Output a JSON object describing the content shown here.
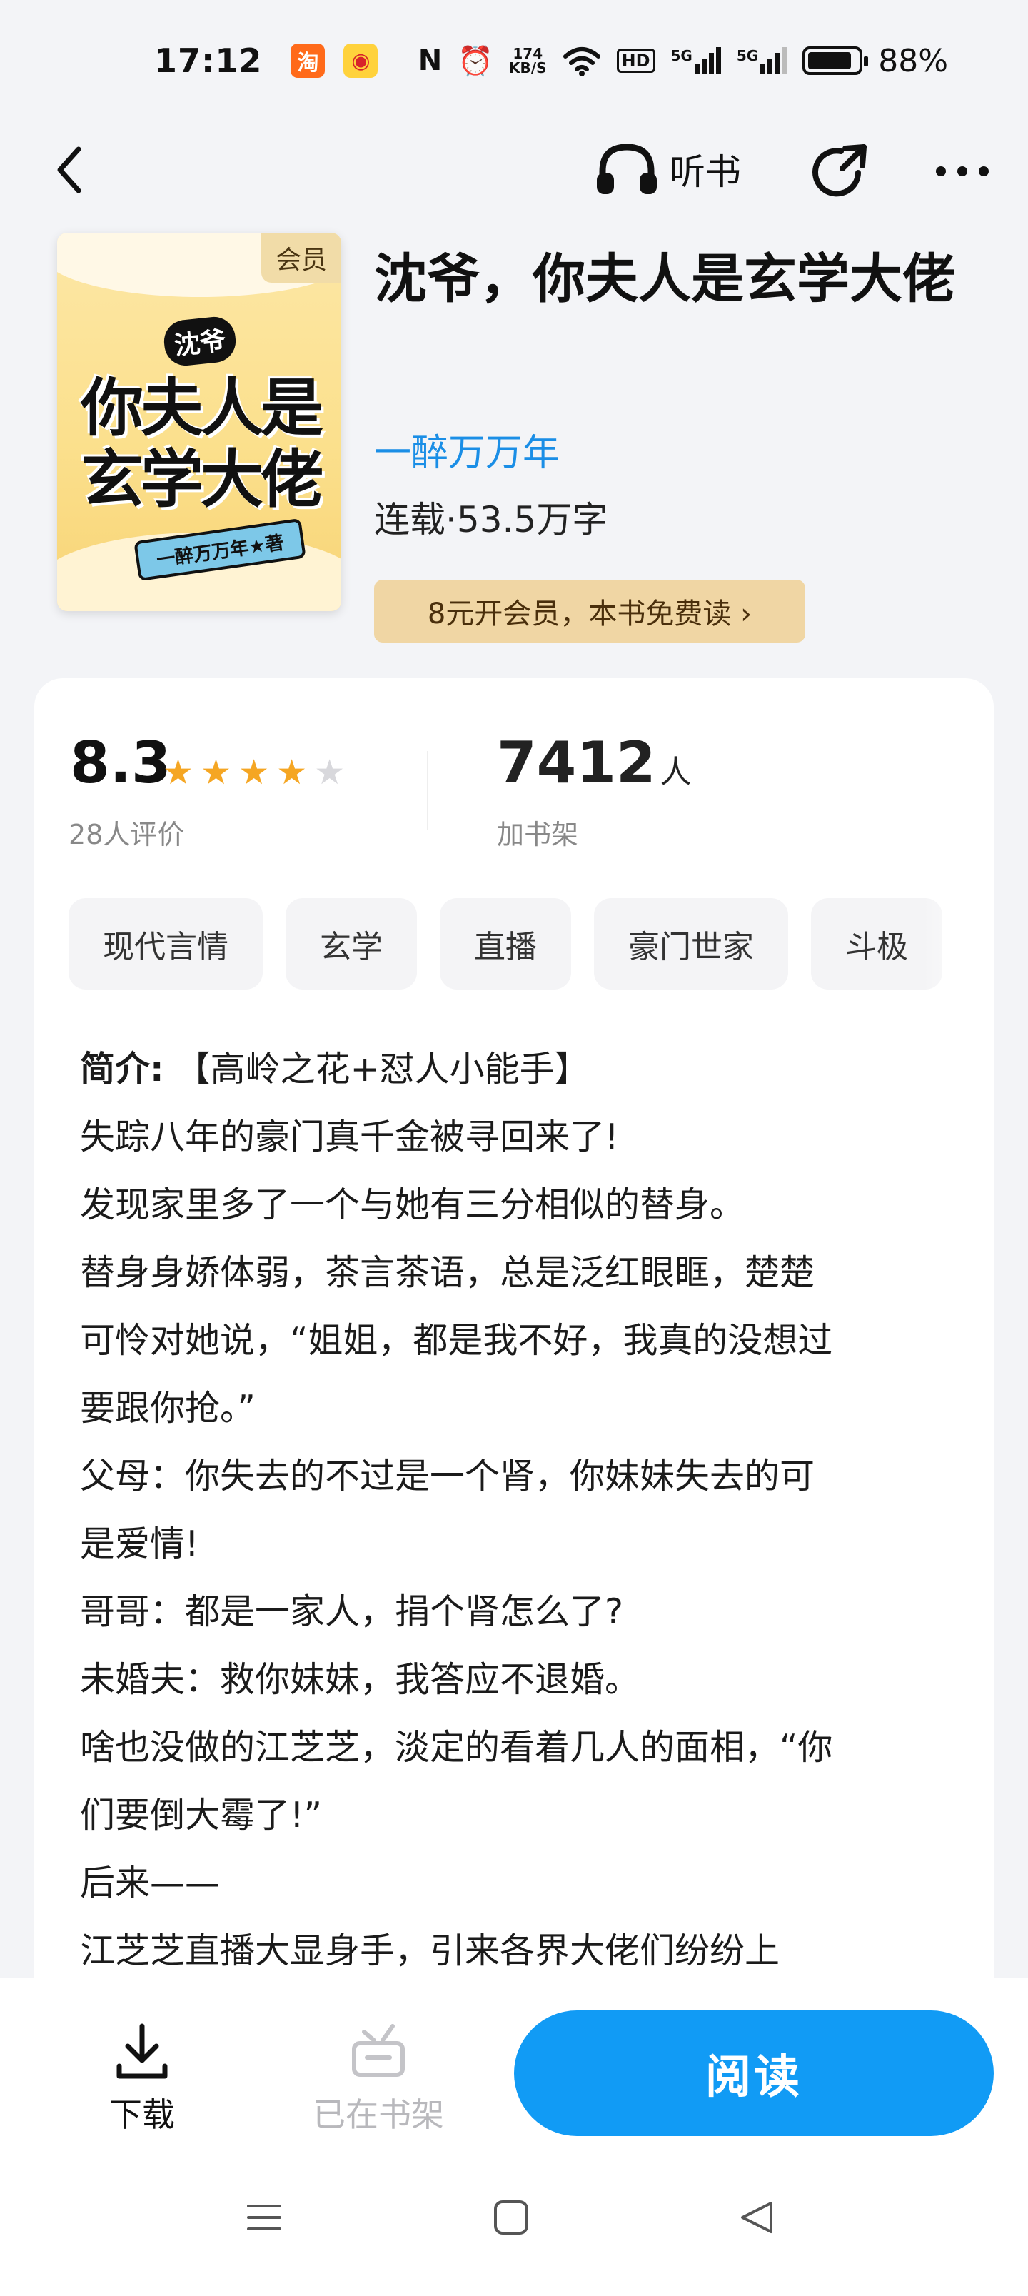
{
  "status_bar": {
    "time": "17:12",
    "app_badges": [
      "taobao-icon",
      "weibo-icon"
    ],
    "nfc": "N",
    "net_speed_top": "174",
    "net_speed_bottom": "KB/S",
    "hd": "HD",
    "signal_1": "5G",
    "signal_2": "5G",
    "battery_level": 0.88,
    "battery_text": "88%"
  },
  "nav": {
    "listen_label": "听书"
  },
  "book": {
    "cover_vip_badge": "会员",
    "cover_subtitle": "沈爷",
    "cover_title": "你夫人是玄学大佬",
    "cover_author": "一醉万万年★著",
    "title": "沈爷，你夫人是玄学大佬",
    "author": "一醉万万年",
    "meta": "连载·53.5万字",
    "vip_offer": "8元开会员，本书免费读 ›"
  },
  "stats": {
    "score": "8.3",
    "stars_filled": 4,
    "stars_total": 5,
    "rating_count": "28人评价",
    "shelf_count": "7412",
    "shelf_unit": "人",
    "shelf_label": "加书架"
  },
  "tags": [
    "现代言情",
    "玄学",
    "直播",
    "豪门世家",
    "斗极"
  ],
  "intro": {
    "label": "简介:",
    "lines": [
      "【高岭之花+怼人小能手】",
      "失踪八年的豪门真千金被寻回来了!",
      "发现家里多了一个与她有三分相似的替身。",
      "替身身娇体弱，茶言茶语，总是泛红眼眶，楚楚",
      "可怜对她说，“姐姐，都是我不好，我真的没想过",
      "要跟你抢。”",
      "父母：你失去的不过是一个肾，你妹妹失去的可",
      "是爱情!",
      "哥哥：都是一家人，捐个肾怎么了?",
      "未婚夫：救你妹妹，我答应不退婚。",
      "啥也没做的江芝芝，淡定的看着几人的面相，“你",
      "们要倒大霉了!”",
      "后来——",
      "江芝芝直播大显身手，引来各界大佬们纷纷上"
    ]
  },
  "bottom": {
    "download_label": "下载",
    "shelf_label": "已在书架",
    "read_label": "阅读"
  },
  "colors": {
    "accent": "#119bf5",
    "author": "#1a8ee6",
    "star": "#f5a623",
    "vip_bg": "#f0d6a4"
  }
}
